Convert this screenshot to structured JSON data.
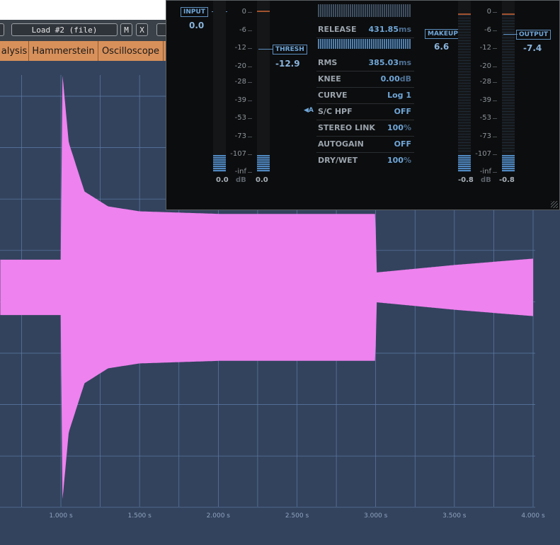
{
  "toolbar": {
    "load_label": "Load #2 (file)",
    "m_label": "M",
    "x_label": "X"
  },
  "tabs": [
    "alysis",
    "Hammerstein",
    "Oscilloscope"
  ],
  "plugin": {
    "input": {
      "label": "INPUT",
      "value": "0.0",
      "meter_value": "0.0"
    },
    "thresh": {
      "label": "THRESH",
      "value": "-12.9",
      "meter_value": "0.0"
    },
    "makeup": {
      "label": "MAKEUP",
      "value": "6.6",
      "meter_value": "-0.8"
    },
    "output": {
      "label": "OUTPUT",
      "value": "-7.4",
      "meter_value": "-0.8"
    },
    "scale": [
      "0",
      "-6",
      "-12",
      "-20",
      "-28",
      "-39",
      "-53",
      "-73",
      "-107",
      "-inf"
    ],
    "scale_unit": "dB",
    "sc_marker": "◀A",
    "params": [
      {
        "key": "RELEASE",
        "value": "431.85",
        "unit": "ms"
      },
      {
        "key": "RMS",
        "value": "385.03",
        "unit": "ms"
      },
      {
        "key": "KNEE",
        "value": "0.00",
        "unit": "dB"
      },
      {
        "key": "CURVE",
        "value": "Log 1",
        "unit": ""
      },
      {
        "key": "S/C HPF",
        "value": "OFF",
        "unit": ""
      },
      {
        "key": "STEREO LINK",
        "value": "100",
        "unit": "%"
      },
      {
        "key": "AUTOGAIN",
        "value": "OFF",
        "unit": ""
      },
      {
        "key": "DRY/WET",
        "value": "100",
        "unit": "%"
      }
    ]
  },
  "chart_data": {
    "type": "area",
    "x_tick_labels": [
      "1.000 s",
      "1.500 s",
      "2.000 s",
      "2.500 s",
      "3.000 s",
      "3.500 s",
      "4.000 s"
    ],
    "x_ticks": [
      1.0,
      1.5,
      2.0,
      2.5,
      3.0,
      3.5,
      4.0
    ],
    "xlim": [
      0.615,
      4.17
    ],
    "ylim": [
      -1,
      1
    ],
    "grid": true,
    "series": [
      {
        "color": "#ee82ee",
        "envelope": [
          {
            "t": 0.615,
            "amp": 0.13
          },
          {
            "t": 0.999,
            "amp": 0.13
          },
          {
            "t": 1.01,
            "amp": 1.0
          },
          {
            "t": 1.05,
            "amp": 0.68
          },
          {
            "t": 1.15,
            "amp": 0.45
          },
          {
            "t": 1.3,
            "amp": 0.38
          },
          {
            "t": 1.5,
            "amp": 0.357
          },
          {
            "t": 2.0,
            "amp": 0.345
          },
          {
            "t": 2.999,
            "amp": 0.345
          },
          {
            "t": 3.005,
            "amp": 0.07
          },
          {
            "t": 3.5,
            "amp": 0.105
          },
          {
            "t": 4.0,
            "amp": 0.135
          }
        ]
      }
    ]
  },
  "colors": {
    "scope_bg": "#33435e",
    "grid": "#5d7da5",
    "waveform": "#ee82ee",
    "tab_bg": "#d38b55",
    "accent": "#6fa6d8"
  }
}
